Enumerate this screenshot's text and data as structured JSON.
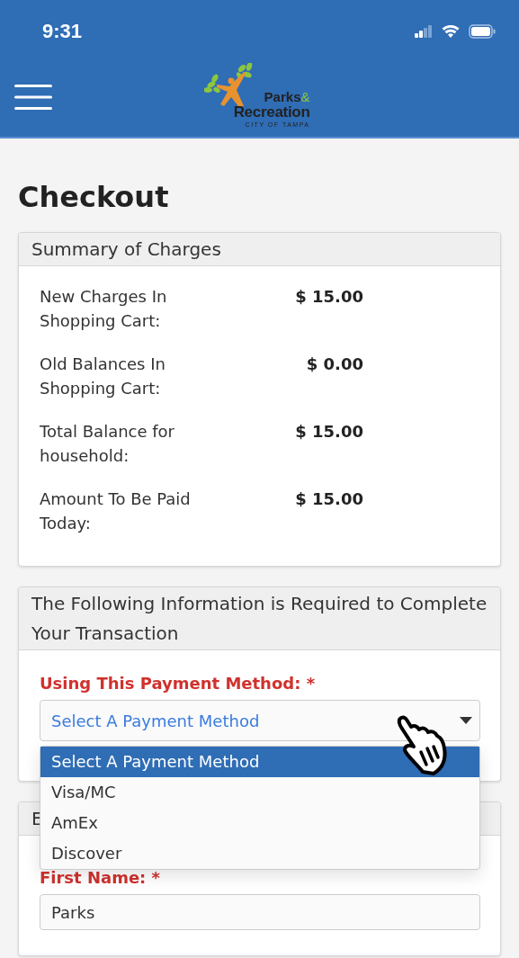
{
  "status_bar": {
    "time": "9:31"
  },
  "header": {
    "logo": {
      "line_1": "Parks",
      "ampersand": "&",
      "line_2": "Recreation",
      "tagline": "CITY OF TAMPA"
    }
  },
  "page_title": "Checkout",
  "summary": {
    "title": "Summary of Charges",
    "rows": [
      {
        "label": "New Charges In Shopping Cart:",
        "value": "$ 15.00"
      },
      {
        "label": "Old Balances In Shopping Cart:",
        "value": "$ 0.00"
      },
      {
        "label": "Total Balance for household:",
        "value": "$ 15.00"
      },
      {
        "label": "Amount To Be Paid Today:",
        "value": "$ 15.00"
      }
    ]
  },
  "payment": {
    "title": "The Following Information is Required to Complete Your Transaction",
    "label": "Using This Payment Method: *",
    "select_value": "Select A Payment Method",
    "options": [
      {
        "label": "Select A Payment Method",
        "selected": true
      },
      {
        "label": "Visa/MC",
        "selected": false
      },
      {
        "label": "AmEx",
        "selected": false
      },
      {
        "label": "Discover",
        "selected": false
      }
    ]
  },
  "billing": {
    "title": "E",
    "fields": [
      {
        "label": "First Name: *",
        "value": "Parks"
      }
    ]
  }
}
